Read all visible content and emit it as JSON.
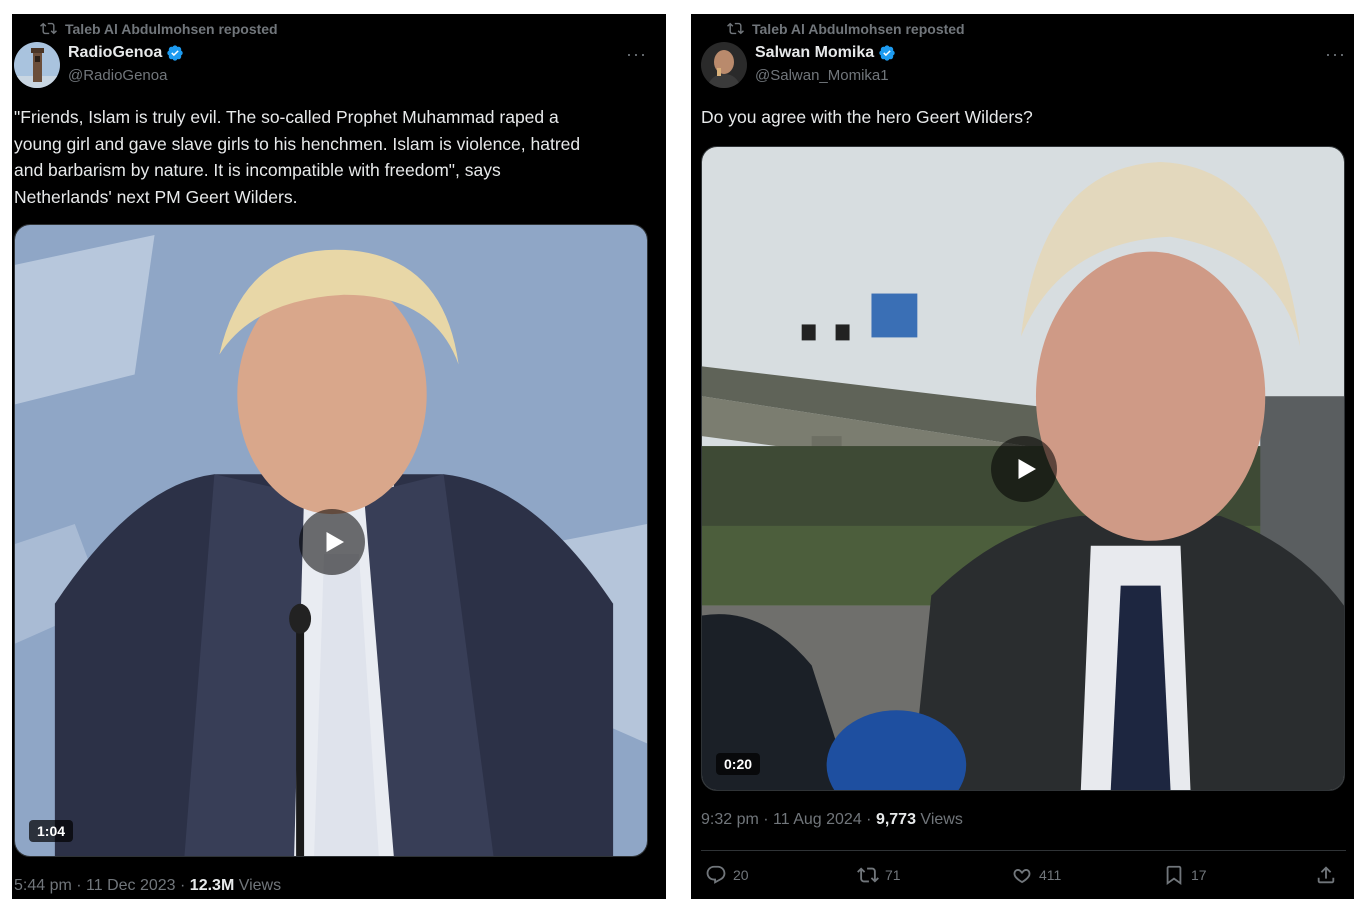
{
  "left_post": {
    "repost_label": "Taleb Al Abdulmohsen reposted",
    "author_name": "RadioGenoa",
    "author_handle": "@RadioGenoa",
    "text": "\"Friends, Islam is truly evil. The so-called Prophet Muhammad raped a\nyoung girl and gave slave girls to his henchmen. Islam is violence, hatred\nand barbarism by nature. It is incompatible with freedom\", says\nNetherlands' next PM Geert Wilders.",
    "video_duration": "1:04",
    "timestamp": "5:44 pm · 11 Dec 2023 · ",
    "views_count": "12.3M",
    "views_label": " Views"
  },
  "right_post": {
    "repost_label": "Taleb Al Abdulmohsen reposted",
    "author_name": "Salwan Momika",
    "author_handle": "@Salwan_Momika1",
    "text": "Do you agree with the hero Geert Wilders?",
    "video_duration": "0:20",
    "timestamp": "9:32 pm · 11 Aug 2024 · ",
    "views_count": "9,773",
    "views_label": " Views",
    "actions": {
      "replies": "20",
      "reposts": "71",
      "likes": "411",
      "bookmarks": "17"
    }
  },
  "more_label": "···",
  "colors": {
    "background": "#000000",
    "text": "#e7e9ea",
    "muted": "#71767b",
    "verified": "#1d9bf0"
  }
}
